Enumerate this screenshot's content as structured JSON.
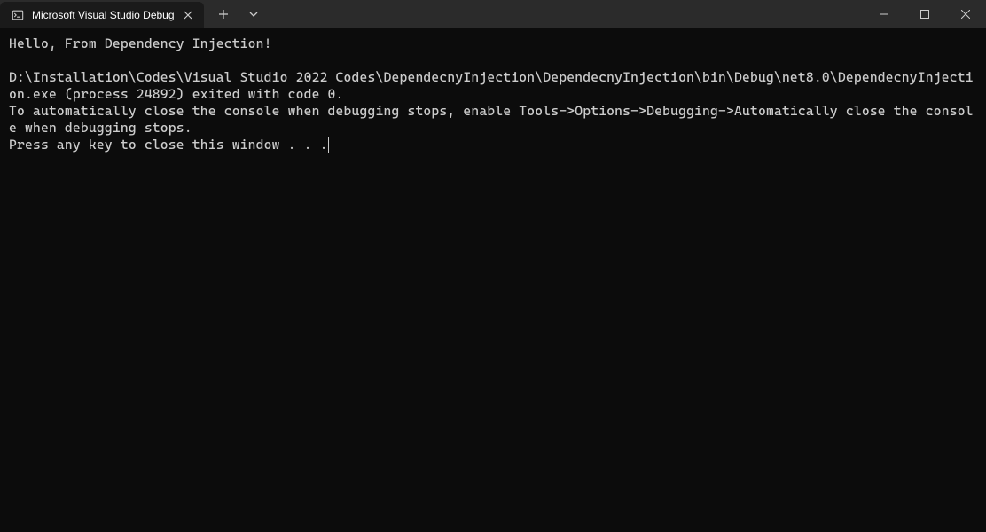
{
  "tab": {
    "title": "Microsoft Visual Studio Debug"
  },
  "console": {
    "line1": "Hello, From Dependency Injection!",
    "line2": "",
    "line3": "D:\\Installation\\Codes\\Visual Studio 2022 Codes\\DependecnyInjection\\DependecnyInjection\\bin\\Debug\\net8.0\\DependecnyInjection.exe (process 24892) exited with code 0.",
    "line4": "To automatically close the console when debugging stops, enable Tools->Options->Debugging->Automatically close the console when debugging stops.",
    "line5": "Press any key to close this window . . ."
  }
}
